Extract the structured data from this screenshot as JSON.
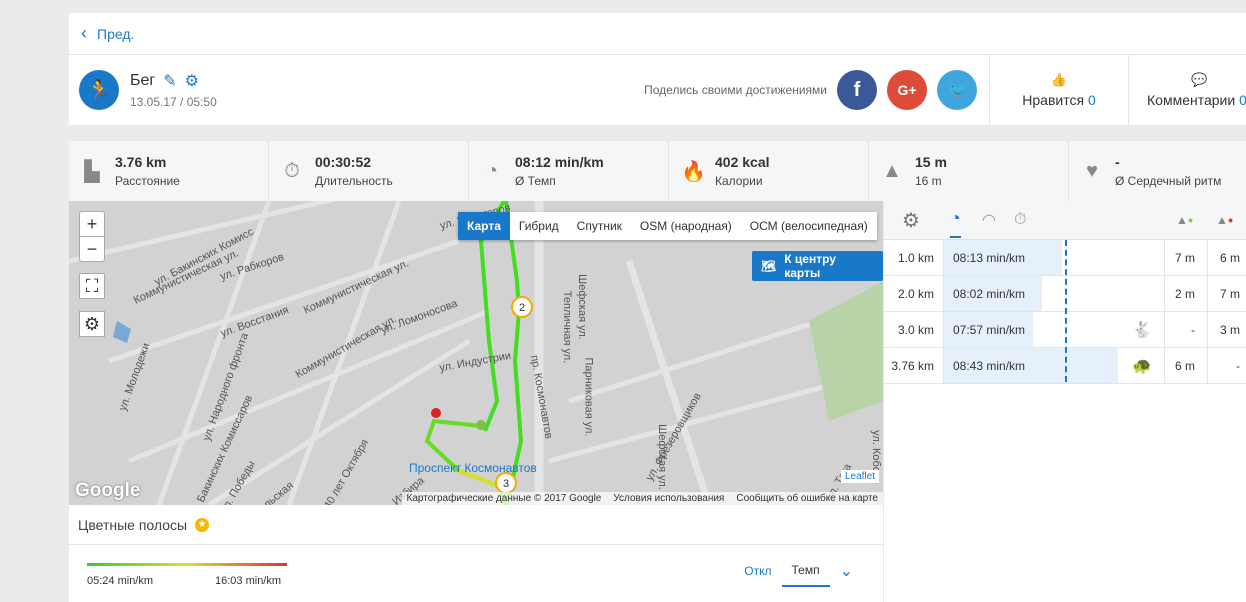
{
  "header": {
    "back_label": "Пред.",
    "activity": "Бег",
    "date": "13.05.17 / 05:50",
    "share_text": "Поделись своими достижениями",
    "like_label": "Нравится",
    "like_count": "0",
    "comments_label": "Комментарии",
    "comments_count": "0"
  },
  "stats": [
    {
      "icon": "road-icon",
      "value": "3.76 km",
      "label": "Расстояние"
    },
    {
      "icon": "stopwatch-icon",
      "value": "00:30:52",
      "label": "Длительность"
    },
    {
      "icon": "pace-icon",
      "value": "08:12 min/km",
      "label": "Ø Темп"
    },
    {
      "icon": "flame-icon",
      "value": "402 kcal",
      "label": "Калории"
    },
    {
      "icon": "elevation-up-icon",
      "value": "15 m",
      "label": "16 m"
    },
    {
      "icon": "heart-icon",
      "value": "-",
      "label": "Ø Сердечный ритм"
    }
  ],
  "map": {
    "tabs": [
      "Карта",
      "Гибрид",
      "Спутник",
      "OSM (народная)",
      "ОСМ (велосипедная)"
    ],
    "active_tab": "Карта",
    "center_button": "К центру карты",
    "zoom_in": "+",
    "zoom_out": "−",
    "google": "Google",
    "leaflet": "Leaflet",
    "attribution": [
      "Картографические данные © 2017 Google",
      "Условия использования",
      "Сообщить об ошибке на карте"
    ],
    "streets": [
      "ул. Бакинских Комисс",
      "ул. Рабкоров",
      "Коммунистическая ул.",
      "ул. Новаторов",
      "ул. Ломоносова",
      "Коммунистическая ул.",
      "ул. Молодежи",
      "ул. Народного фронта",
      "ул. Бакинских Комиссаров",
      "ул. Восстания",
      "Коммунистическая ул.",
      "ул. Индустрии",
      "пр. Космонавтов",
      "Шефская ул.",
      "Тепличная ул.",
      "Парниковая ул.",
      "ул. Фрезеровщиков",
      "Шефская ул.",
      "ул. Победы",
      "ул. 40 лет Октября",
      "ул. Избира",
      "ул. Уральская",
      "Проспект Космонавтов",
      "ул. Кобозе",
      "ул. Тага"
    ],
    "markers": [
      "2",
      "3"
    ]
  },
  "bands": {
    "title": "Цветные полосы",
    "min": "05:24 min/km",
    "max": "16:03 min/km",
    "off": "Откл",
    "pace": "Темп",
    "colors": [
      "#33cc33",
      "#dddd33",
      "#dd3333"
    ]
  },
  "splits": {
    "accent": "#1a78c8",
    "avg_pace": "08:12",
    "rows": [
      {
        "dist": "1.0 km",
        "pace": "08:13 min/km",
        "sec": 493,
        "badge": "",
        "up": "7 m",
        "down": "6 m"
      },
      {
        "dist": "2.0 km",
        "pace": "08:02 min/km",
        "sec": 482,
        "badge": "",
        "up": "2 m",
        "down": "7 m"
      },
      {
        "dist": "3.0 km",
        "pace": "07:57 min/km",
        "sec": 477,
        "badge": "rabbit-icon",
        "up": "-",
        "down": "3 m"
      },
      {
        "dist": "3.76 km",
        "pace": "08:43 min/km",
        "sec": 523,
        "badge": "turtle-icon",
        "up": "6 m",
        "down": "-"
      }
    ]
  }
}
